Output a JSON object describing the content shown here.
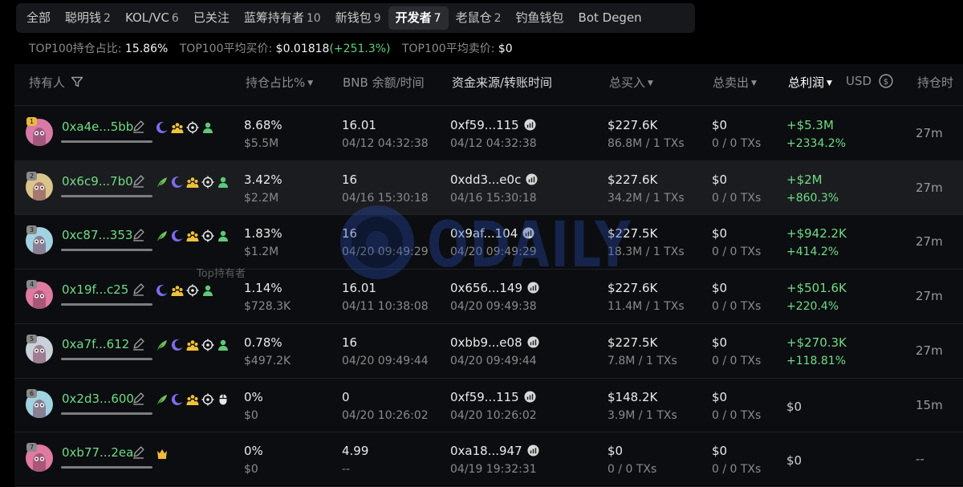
{
  "tabs": [
    {
      "label": "全部",
      "count": ""
    },
    {
      "label": "聪明钱",
      "count": "2"
    },
    {
      "label": "KOL/VC",
      "count": "6"
    },
    {
      "label": "已关注",
      "count": ""
    },
    {
      "label": "蓝筹持有者",
      "count": "10"
    },
    {
      "label": "新钱包",
      "count": "9"
    },
    {
      "label": "开发者",
      "count": "7",
      "active": true
    },
    {
      "label": "老鼠仓",
      "count": "2"
    },
    {
      "label": "钓鱼钱包",
      "count": ""
    },
    {
      "label": "Bot Degen",
      "count": ""
    }
  ],
  "stats": {
    "top100_holding_label": "TOP100持仓占比:",
    "top100_holding_value": "15.86%",
    "top100_avg_buy_label": "TOP100平均买价:",
    "top100_avg_buy_value": "$0.01818",
    "top100_avg_buy_change": "(+251.3%)",
    "top100_avg_sell_label": "TOP100平均卖价:",
    "top100_avg_sell_value": "$0"
  },
  "headers": {
    "holder": "持有人",
    "holding_pct": "持仓占比%",
    "bnb_balance": "BNB 余额/时间",
    "funding": "资金来源/转账时间",
    "total_buy": "总买入",
    "total_sell": "总卖出",
    "total_profit": "总利润",
    "currency": "USD",
    "hold_time": "持仓时"
  },
  "tooltip": "Top持有者",
  "watermark": "ODAILY",
  "accent_green": "#6fdc85",
  "rows": [
    {
      "rank": "1",
      "address": "0xa4e...5bb",
      "tags": [
        "purple-moon-icon",
        "group-icon",
        "target-icon",
        "person-icon"
      ],
      "holding_pct": "8.68%",
      "holding_value": "$5.5M",
      "bnb": "16.01",
      "bnb_time": "04/12 04:32:38",
      "fund_src": "0xf59...115",
      "fund_time": "04/12 04:32:38",
      "buy": "$227.6K",
      "buy_sub": "86.8M / 1 TXs",
      "sell": "$0",
      "sell_sub": "0 / 0 TXs",
      "profit": "+$5.3M",
      "profit_pct": "+2334.2%",
      "hold": "27m",
      "avatar_color": "#d87aa8"
    },
    {
      "rank": "2",
      "address": "0x6c9...7b0",
      "tags": [
        "leaf-icon",
        "purple-moon-icon",
        "group-icon",
        "target-icon",
        "person-icon"
      ],
      "holding_pct": "3.42%",
      "holding_value": "$2.2M",
      "bnb": "16",
      "bnb_time": "04/16 15:30:18",
      "fund_src": "0xdd3...e0c",
      "fund_time": "04/16 15:30:18",
      "buy": "$227.6K",
      "buy_sub": "34.2M / 1 TXs",
      "sell": "$0",
      "sell_sub": "0 / 0 TXs",
      "profit": "+$2M",
      "profit_pct": "+860.3%",
      "hold": "27m",
      "avatar_color": "#d9c48a"
    },
    {
      "rank": "3",
      "address": "0xc87...353",
      "tags": [
        "leaf-icon",
        "purple-moon-icon",
        "group-icon",
        "target-icon",
        "person-icon"
      ],
      "holding_pct": "1.83%",
      "holding_value": "$1.2M",
      "bnb": "16",
      "bnb_time": "04/20 09:49:29",
      "fund_src": "0x9af...104",
      "fund_time": "04/20 09:49:29",
      "buy": "$227.5K",
      "buy_sub": "18.3M / 1 TXs",
      "sell": "$0",
      "sell_sub": "0 / 0 TXs",
      "profit": "+$942.2K",
      "profit_pct": "+414.2%",
      "hold": "27m",
      "avatar_color": "#9fd3e0"
    },
    {
      "rank": "4",
      "address": "0x19f...c25",
      "tags": [
        "purple-moon-icon",
        "group-icon",
        "target-icon",
        "person-icon"
      ],
      "holding_pct": "1.14%",
      "holding_value": "$728.3K",
      "bnb": "16.01",
      "bnb_time": "04/11 10:38:08",
      "fund_src": "0x656...149",
      "fund_time": "04/20 09:49:38",
      "buy": "$227.6K",
      "buy_sub": "11.4M / 1 TXs",
      "sell": "$0",
      "sell_sub": "0 / 0 TXs",
      "profit": "+$501.6K",
      "profit_pct": "+220.4%",
      "hold": "27m",
      "avatar_color": "#e07aa0"
    },
    {
      "rank": "5",
      "address": "0xa7f...612",
      "tags": [
        "leaf-icon",
        "purple-moon-icon",
        "group-icon",
        "target-icon",
        "person-icon"
      ],
      "holding_pct": "0.78%",
      "holding_value": "$497.2K",
      "bnb": "16",
      "bnb_time": "04/20 09:49:44",
      "fund_src": "0xbb9...e08",
      "fund_time": "04/20 09:49:44",
      "buy": "$227.5K",
      "buy_sub": "7.8M / 1 TXs",
      "sell": "$0",
      "sell_sub": "0 / 0 TXs",
      "profit": "+$270.3K",
      "profit_pct": "+118.81%",
      "hold": "27m",
      "avatar_color": "#c8d0d8"
    },
    {
      "rank": "6",
      "address": "0x2d3...600",
      "tags": [
        "leaf-icon",
        "purple-moon-icon",
        "group-icon",
        "target-icon",
        "mouse-icon"
      ],
      "holding_pct": "0%",
      "holding_value": "$0",
      "bnb": "0",
      "bnb_time": "04/20 10:26:02",
      "fund_src": "0xf59...115",
      "fund_time": "04/20 10:26:02",
      "buy": "$148.2K",
      "buy_sub": "3.9M / 1 TXs",
      "sell": "$0",
      "sell_sub": "0 / 0 TXs",
      "profit": "$0",
      "profit_pct": "",
      "hold": "15m",
      "avatar_color": "#9fd3e0"
    },
    {
      "rank": "7",
      "address": "0xb77...2ea",
      "tags": [
        "crown-icon"
      ],
      "holding_pct": "0%",
      "holding_value": "$0",
      "bnb": "4.99",
      "bnb_time": "--",
      "fund_src": "0xa18...947",
      "fund_time": "04/19 19:32:31",
      "buy": "$0",
      "buy_sub": "0 / 0 TXs",
      "sell": "$0",
      "sell_sub": "0 / 0 TXs",
      "profit": "$0",
      "profit_pct": "",
      "hold": "--",
      "avatar_color": "#e07aa0"
    }
  ]
}
